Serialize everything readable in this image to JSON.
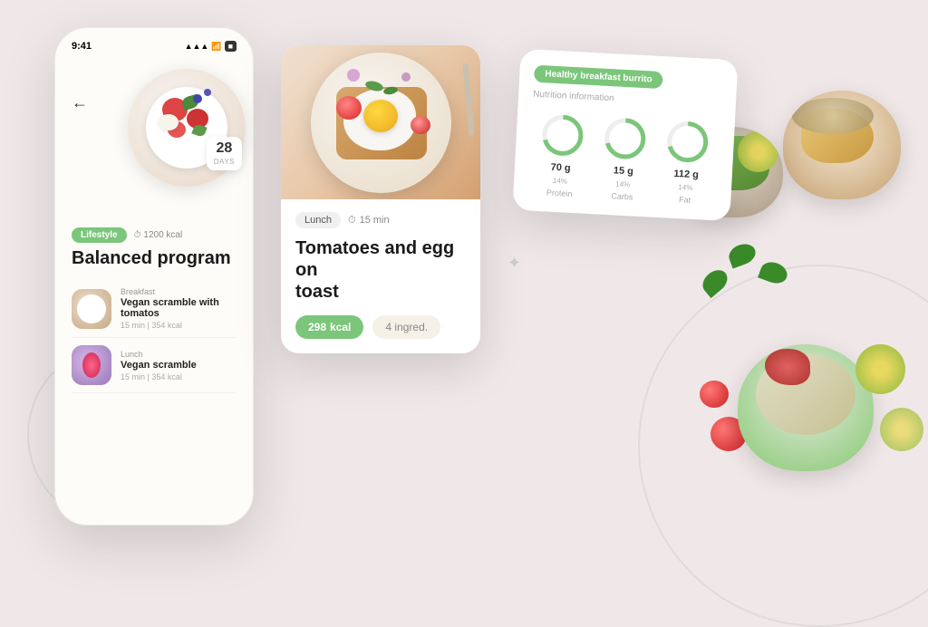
{
  "app": {
    "background_color": "#f0e8e8"
  },
  "phone": {
    "time": "9:41",
    "back_arrow": "←",
    "days_number": "28",
    "days_label": "DAYS",
    "lifestyle_tag": "Lifestyle",
    "kcal_tag": "1200 kcal",
    "program_title": "Balanced program",
    "meals": [
      {
        "category": "Breakfast",
        "name": "Vegan scramble with tomatos",
        "meta": "15 min | 354 kcal"
      },
      {
        "category": "Lunch",
        "name": "Vegan scramble",
        "meta": "15 min | 354 kcal"
      }
    ]
  },
  "recipe_card": {
    "tag": "Lunch",
    "time": "15 min",
    "title_line1": "Tomatoes and egg on",
    "title_line2": "toast",
    "kcal": "298",
    "kcal_label": "kcal",
    "ingredients": "4",
    "ingredients_label": "ingred."
  },
  "nutrition_card": {
    "title": "Healthy breakfast burrito",
    "subtitle": "Nutrition information",
    "protein_value": "70 g",
    "protein_pct": "14%",
    "protein_label": "Protein",
    "carbs_value": "15 g",
    "carbs_pct": "14%",
    "carbs_label": "Carbs",
    "fat_value": "112 g",
    "fat_pct": "14%",
    "fat_label": "Fat"
  },
  "icons": {
    "back": "←",
    "clock": "⏱",
    "kcal_icon": "⚡",
    "sparkle1": "✦",
    "sparkle2": "✦",
    "sparkle3": "✦"
  }
}
